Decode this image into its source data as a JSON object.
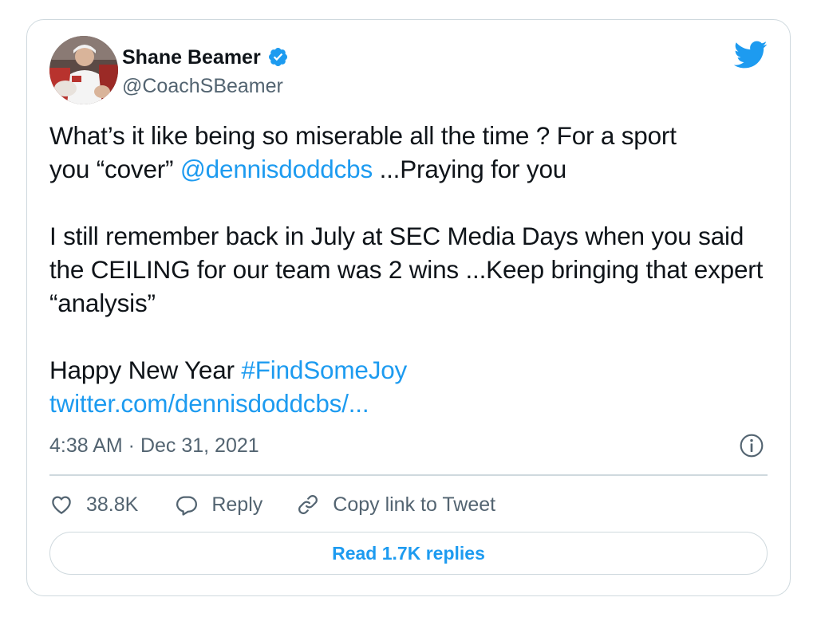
{
  "author": {
    "display_name": "Shane Beamer",
    "handle": "@CoachSBeamer",
    "verified": true,
    "avatar_icon": "profile-photo"
  },
  "brand": {
    "logo_icon": "twitter-bird-icon",
    "accent_color": "#1d9bf0"
  },
  "tweet": {
    "line1_text": "What’s it like being so miserable all the time ? For a sport",
    "line2_prefix": "you “cover” ",
    "mention": "@dennisdoddcbs",
    "line2_suffix": " ...Praying for you",
    "para2": "I still remember back in July at SEC Media Days when you said the CEILING for our team was 2 wins ...Keep bringing that expert “analysis”",
    "para3_prefix": "Happy New Year ",
    "hashtag": "#FindSomeJoy",
    "link": "twitter.com/dennisdoddcbs/..."
  },
  "meta": {
    "timestamp": "4:38 AM · Dec 31, 2021",
    "info_icon": "info-icon"
  },
  "actions": {
    "like_count": "38.8K",
    "reply_label": "Reply",
    "copy_link_label": "Copy link to Tweet"
  },
  "replies_button": {
    "label": "Read 1.7K replies"
  }
}
